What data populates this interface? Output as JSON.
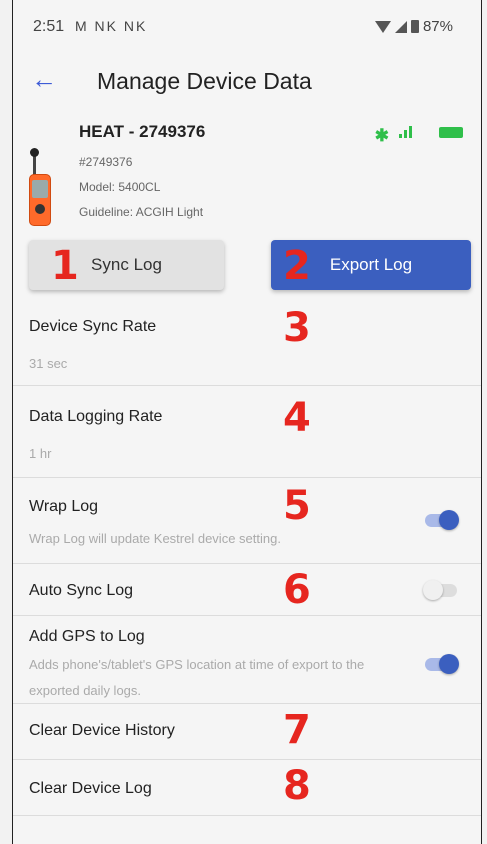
{
  "status_bar": {
    "time": "2:51",
    "notifications": "M NK NK",
    "battery": "87%"
  },
  "header": {
    "title": "Manage Device Data",
    "back_icon": "arrow-left-icon"
  },
  "device": {
    "name": "HEAT - 2749376",
    "serial": "#2749376",
    "model": "Model: 5400CL",
    "guideline": "Guideline: ACGIH Light",
    "bluetooth_glyph": "✱",
    "accent_color": "#2fbf4a"
  },
  "actions": {
    "sync_label": "Sync Log",
    "export_label": "Export Log",
    "export_color": "#3b5fbf"
  },
  "annotations": [
    "1",
    "2",
    "3",
    "4",
    "5",
    "6",
    "7",
    "8"
  ],
  "settings": {
    "sync_rate": {
      "label": "Device Sync Rate",
      "value": "31 sec"
    },
    "logging_rate": {
      "label": "Data Logging Rate",
      "value": "1 hr"
    },
    "wrap_log": {
      "label": "Wrap Log",
      "desc": "Wrap Log will update Kestrel device setting.",
      "enabled": true
    },
    "auto_sync": {
      "label": "Auto Sync Log",
      "enabled": false
    },
    "add_gps": {
      "label": "Add GPS to Log",
      "desc": "Adds phone's/tablet's GPS location at time of export to the exported daily logs.",
      "enabled": true
    },
    "clear_history": {
      "label": "Clear Device History"
    },
    "clear_log": {
      "label": "Clear Device Log"
    }
  }
}
